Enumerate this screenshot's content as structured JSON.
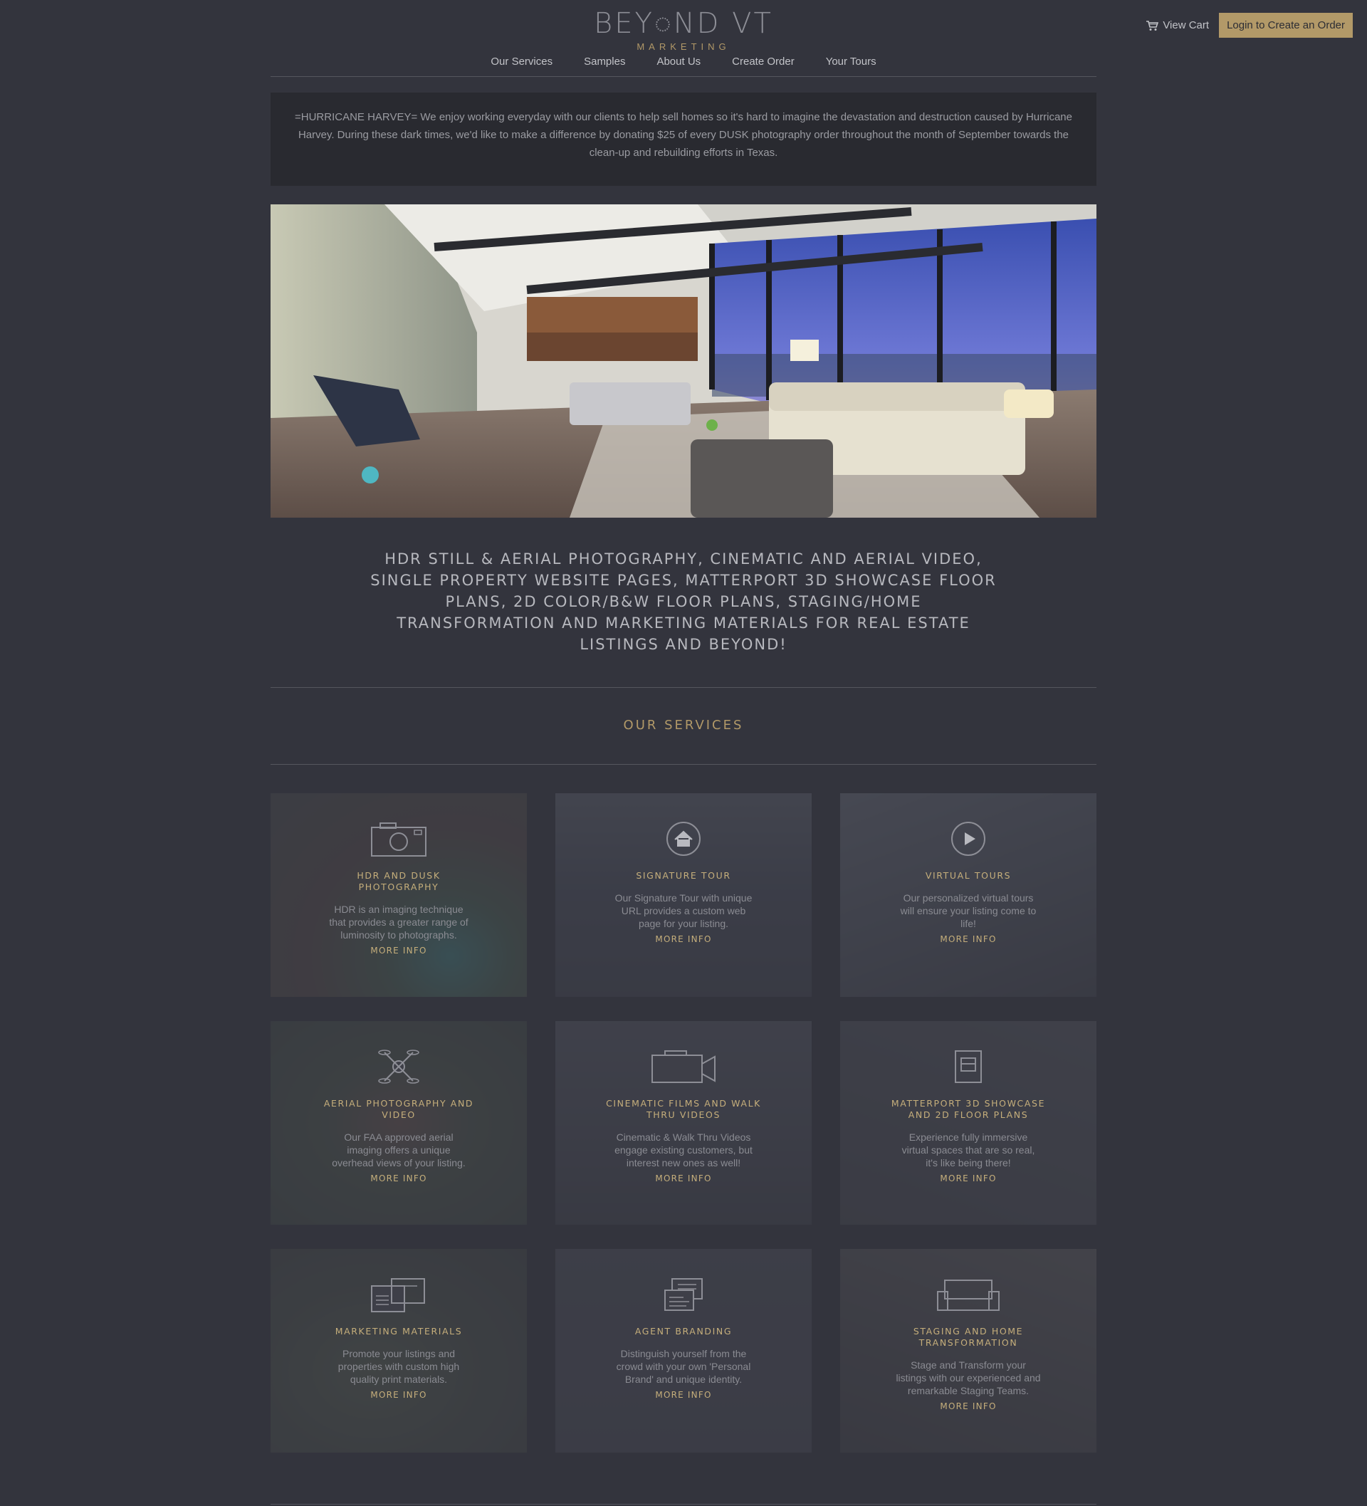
{
  "brand": {
    "logo_main": "BEY◌ND VT",
    "logo_sub": "MARKETING"
  },
  "header": {
    "cart_label": "View Cart",
    "login_label": "Login to Create an Order"
  },
  "nav": [
    "Our Services",
    "Samples",
    "About Us",
    "Create Order",
    "Your Tours"
  ],
  "notice": "=HURRICANE HARVEY= We enjoy working everyday with our clients to help sell homes so it's hard to imagine the devastation and destruction caused by Hurricane Harvey. During these dark times, we'd like to make a difference by donating $25 of every DUSK photography order throughout the month of September towards the clean-up and rebuilding efforts in Texas.",
  "tagline": "HDR still & aerial photography, cinematic and aerial video, single property website pages, Matterport 3D Showcase floor plans, 2D color/B&W floor plans, staging/home transformation and marketing materials for real estate listings and beyond!",
  "services_title": "OUR SERVICES",
  "colors": {
    "background": "#33343d",
    "accent": "#b29968",
    "notice_bg": "#292a30"
  },
  "services": [
    {
      "title": "HDR AND DUSK PHOTOGRAPHY",
      "desc": "HDR is an imaging technique that provides a greater range of luminosity to photographs.",
      "more": "MORE INFO",
      "icon": "camera-icon"
    },
    {
      "title": "SIGNATURE TOUR",
      "desc": "Our Signature Tour with unique URL provides a custom web page for your listing.",
      "more": "MORE INFO",
      "icon": "home-icon"
    },
    {
      "title": "VIRTUAL TOURS",
      "desc": "Our personalized virtual tours will ensure your listing come to life!",
      "more": "MORE INFO",
      "icon": "play-icon"
    },
    {
      "title": "AERIAL PHOTOGRAPHY AND VIDEO",
      "desc": "Our FAA approved aerial imaging offers a unique overhead views of your listing.",
      "more": "MORE INFO",
      "icon": "drone-icon"
    },
    {
      "title": "CINEMATIC FILMS AND WALK THRU VIDEOS",
      "desc": "Cinematic & Walk Thru Videos engage existing customers, but interest new ones as well!",
      "more": "MORE INFO",
      "icon": "video-camera-icon"
    },
    {
      "title": "MATTERPORT 3D SHOWCASE AND 2D FLOOR PLANS",
      "desc": "Experience fully immersive virtual spaces that are so real, it's like being there!",
      "more": "MORE INFO",
      "icon": "floor-plan-icon"
    },
    {
      "title": "MARKETING MATERIALS",
      "desc": "Promote your listings and properties with custom high quality print materials.",
      "more": "MORE INFO",
      "icon": "brochure-icon"
    },
    {
      "title": "AGENT BRANDING",
      "desc": "Distinguish yourself from the crowd with your own 'Personal Brand' and unique identity.",
      "more": "MORE INFO",
      "icon": "business-card-icon"
    },
    {
      "title": "STAGING AND HOME TRANSFORMATION",
      "desc": "Stage and Transform your listings with our experienced and remarkable Staging Teams.",
      "more": "MORE INFO",
      "icon": "sofa-icon"
    }
  ]
}
